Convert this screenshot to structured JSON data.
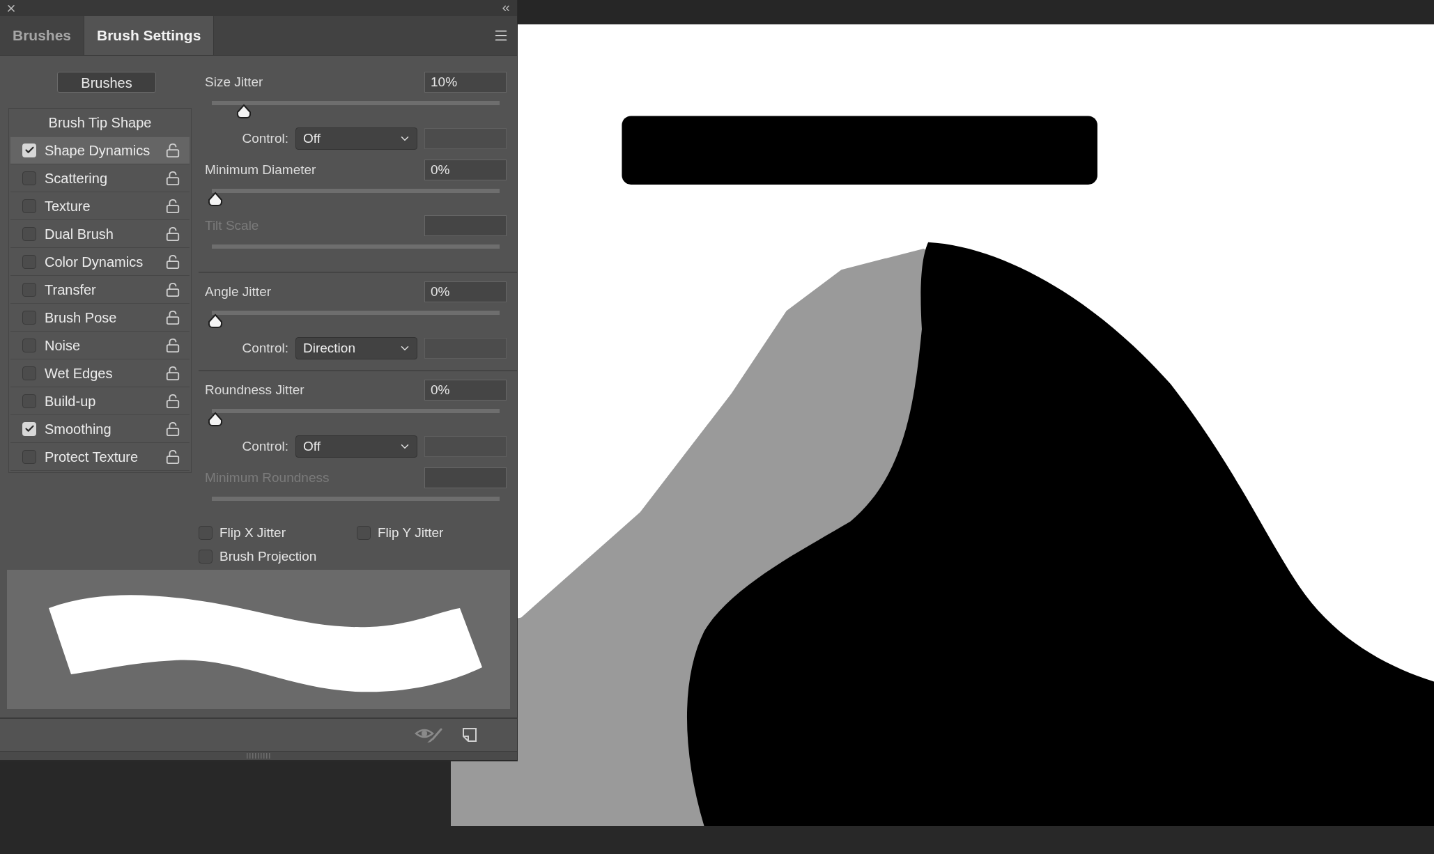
{
  "panel": {
    "tabs": [
      {
        "label": "Brushes",
        "selected": false
      },
      {
        "label": "Brush Settings",
        "selected": true
      }
    ],
    "brushes_button": "Brushes",
    "brush_tip_shape": "Brush Tip Shape",
    "options": [
      {
        "label": "Shape Dynamics",
        "checked": true,
        "selected": true
      },
      {
        "label": "Scattering",
        "checked": false,
        "selected": false
      },
      {
        "label": "Texture",
        "checked": false,
        "selected": false
      },
      {
        "label": "Dual Brush",
        "checked": false,
        "selected": false
      },
      {
        "label": "Color Dynamics",
        "checked": false,
        "selected": false
      },
      {
        "label": "Transfer",
        "checked": false,
        "selected": false
      },
      {
        "label": "Brush Pose",
        "checked": false,
        "selected": false
      },
      {
        "label": "Noise",
        "checked": false,
        "selected": false
      },
      {
        "label": "Wet Edges",
        "checked": false,
        "selected": false
      },
      {
        "label": "Build-up",
        "checked": false,
        "selected": false
      },
      {
        "label": "Smoothing",
        "checked": true,
        "selected": false
      },
      {
        "label": "Protect Texture",
        "checked": false,
        "selected": false
      }
    ],
    "settings": [
      {
        "kind": "slider",
        "label": "Size Jitter",
        "value": "10%",
        "level": 0.1,
        "disabled": false
      },
      {
        "kind": "control",
        "label": "Control:",
        "value": "Off"
      },
      {
        "kind": "slider",
        "label": "Minimum Diameter",
        "value": "0%",
        "level": 0,
        "disabled": false
      },
      {
        "kind": "slider",
        "label": "Tilt Scale",
        "disabled": true
      },
      {
        "kind": "divider"
      },
      {
        "kind": "slider",
        "label": "Angle Jitter",
        "value": "0%",
        "level": 0,
        "disabled": false
      },
      {
        "kind": "control",
        "label": "Control:",
        "value": "Direction"
      },
      {
        "kind": "divider"
      },
      {
        "kind": "slider",
        "label": "Roundness Jitter",
        "value": "0%",
        "level": 0,
        "disabled": false
      },
      {
        "kind": "control",
        "label": "Control:",
        "value": "Off"
      },
      {
        "kind": "slider",
        "label": "Minimum Roundness",
        "disabled": true
      }
    ],
    "flips": [
      {
        "label": "Flip X Jitter",
        "checked": false
      },
      {
        "label": "Flip Y Jitter",
        "checked": false
      },
      {
        "label": "Brush Projection",
        "checked": false
      }
    ]
  }
}
